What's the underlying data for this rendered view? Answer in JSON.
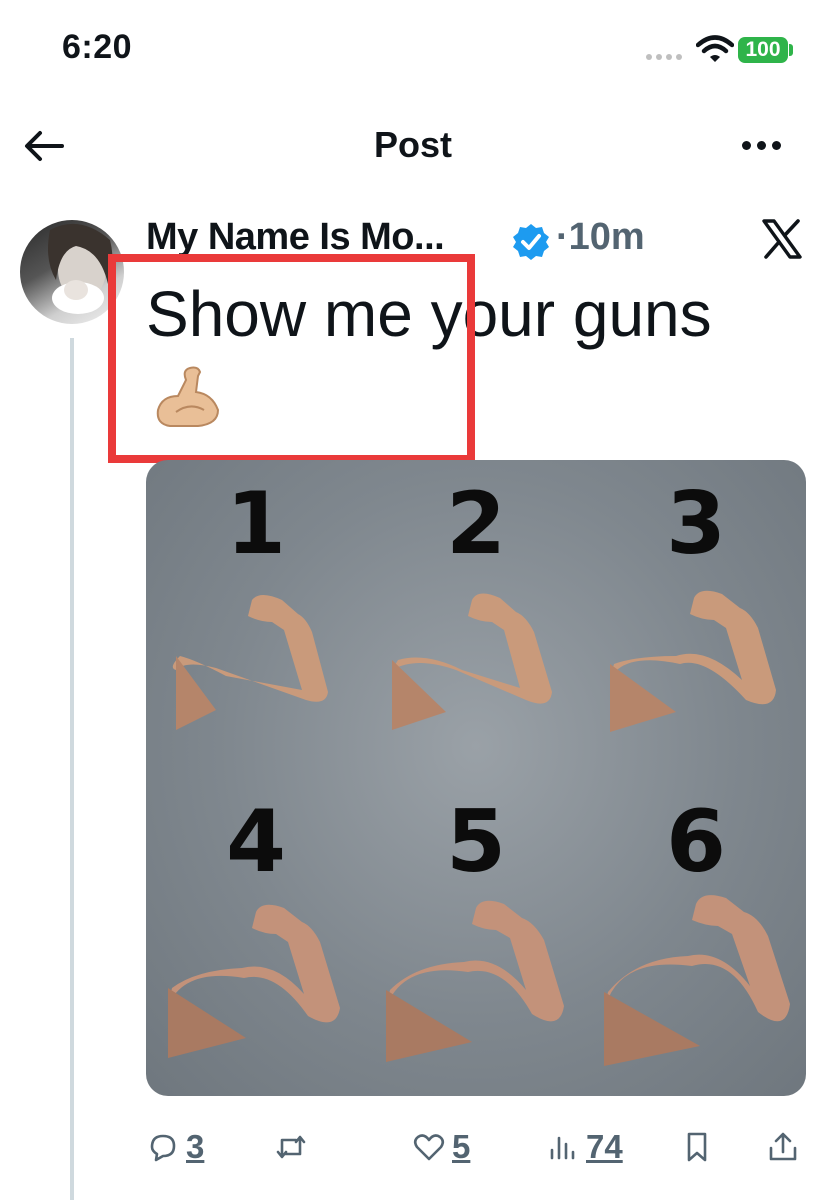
{
  "status_bar": {
    "time": "6:20",
    "battery": "100"
  },
  "header": {
    "title": "Post"
  },
  "tweet": {
    "author_name": "My Name Is Mo...",
    "separator": "·",
    "time_ago": "10m",
    "text": "Show me your guns",
    "emoji": "flexed-biceps"
  },
  "media": {
    "labels": [
      "1",
      "2",
      "3",
      "4",
      "5",
      "6"
    ]
  },
  "actions": {
    "replies": "3",
    "likes": "5",
    "views": "74"
  },
  "colors": {
    "verified": "#1d9bf0",
    "highlight": "#ea3a3a",
    "battery": "#2fb44a",
    "muted": "#536471"
  }
}
